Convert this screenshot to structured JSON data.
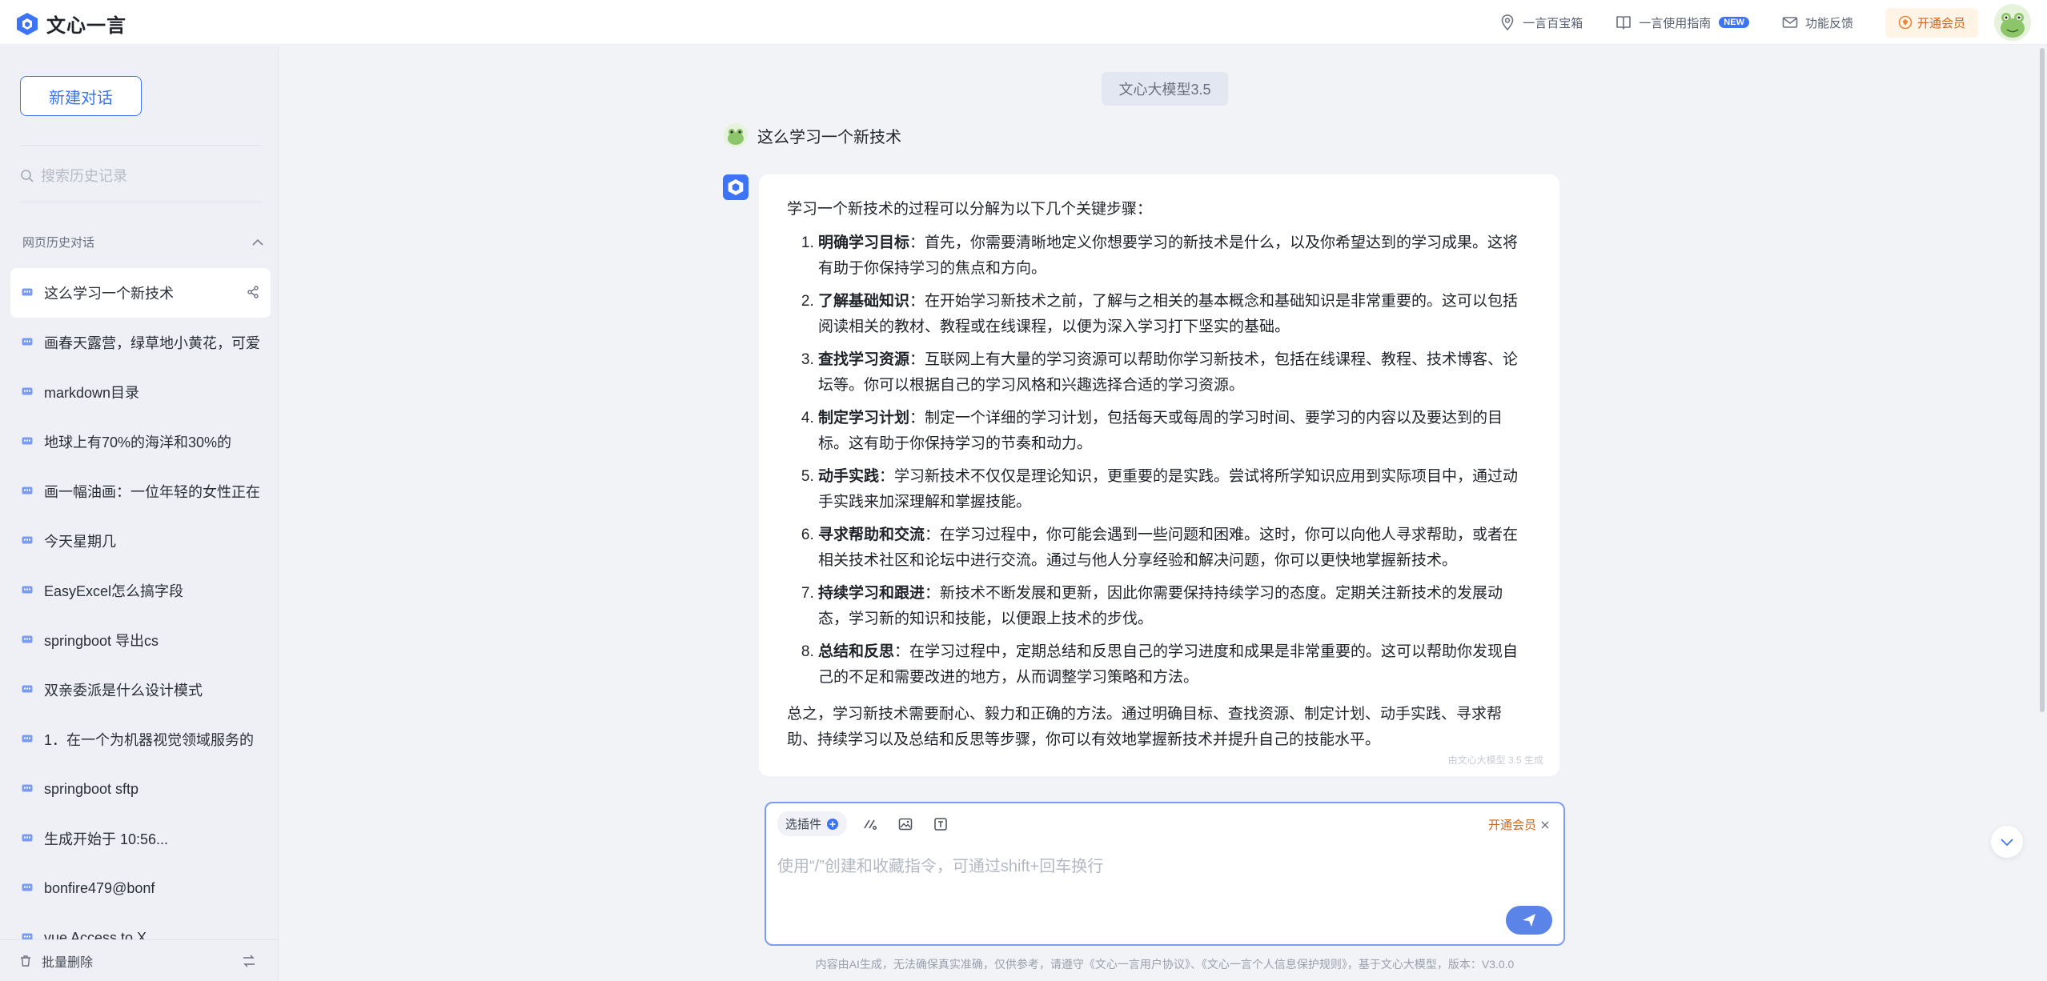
{
  "app": {
    "name": "文心一言"
  },
  "header": {
    "links": [
      {
        "label": "一言百宝箱",
        "icon": "location-pin-icon"
      },
      {
        "label": "一言使用指南",
        "icon": "book-icon",
        "badge": "NEW"
      },
      {
        "label": "功能反馈",
        "icon": "mail-icon"
      }
    ],
    "vip_label": "开通会员"
  },
  "sidebar": {
    "new_chat_label": "新建对话",
    "search_placeholder": "搜索历史记录",
    "history_header": "网页历史对话",
    "items": [
      {
        "label": "这么学习一个新技术"
      },
      {
        "label": "画春天露营，绿草地小黄花，可爱"
      },
      {
        "label": "markdown目录"
      },
      {
        "label": "地球上有70%的海洋和30%的"
      },
      {
        "label": "画一幅油画：一位年轻的女性正在"
      },
      {
        "label": "今天星期几"
      },
      {
        "label": "EasyExcel怎么搞字段"
      },
      {
        "label": "springboot 导出cs"
      },
      {
        "label": "双亲委派是什么设计模式"
      },
      {
        "label": "1．在一个为机器视觉领域服务的"
      },
      {
        "label": "springboot sftp"
      },
      {
        "label": "生成开始于 10:56..."
      },
      {
        "label": "bonfire479@bonf"
      },
      {
        "label": "vue Access to X"
      }
    ],
    "bulk_delete_label": "批量删除"
  },
  "chat": {
    "model_tag": "文心大模型3.5",
    "user_question": "这么学习一个新技术",
    "answer": {
      "intro": "学习一个新技术的过程可以分解为以下几个关键步骤：",
      "steps": [
        {
          "title": "明确学习目标",
          "text": "：首先，你需要清晰地定义你想要学习的新技术是什么，以及你希望达到的学习成果。这将有助于你保持学习的焦点和方向。"
        },
        {
          "title": "了解基础知识",
          "text": "：在开始学习新技术之前，了解与之相关的基本概念和基础知识是非常重要的。这可以包括阅读相关的教材、教程或在线课程，以便为深入学习打下坚实的基础。"
        },
        {
          "title": "查找学习资源",
          "text": "：互联网上有大量的学习资源可以帮助你学习新技术，包括在线课程、教程、技术博客、论坛等。你可以根据自己的学习风格和兴趣选择合适的学习资源。"
        },
        {
          "title": "制定学习计划",
          "text": "：制定一个详细的学习计划，包括每天或每周的学习时间、要学习的内容以及要达到的目标。这有助于你保持学习的节奏和动力。"
        },
        {
          "title": "动手实践",
          "text": "：学习新技术不仅仅是理论知识，更重要的是实践。尝试将所学知识应用到实际项目中，通过动手实践来加深理解和掌握技能。"
        },
        {
          "title": "寻求帮助和交流",
          "text": "：在学习过程中，你可能会遇到一些问题和困难。这时，你可以向他人寻求帮助，或者在相关技术社区和论坛中进行交流。通过与他人分享经验和解决问题，你可以更快地掌握新技术。"
        },
        {
          "title": "持续学习和跟进",
          "text": "：新技术不断发展和更新，因此你需要保持持续学习的态度。定期关注新技术的发展动态，学习新的知识和技能，以便跟上技术的步伐。"
        },
        {
          "title": "总结和反思",
          "text": "：在学习过程中，定期总结和反思自己的学习进度和成果是非常重要的。这可以帮助你发现自己的不足和需要改进的地方，从而调整学习策略和方法。"
        }
      ],
      "summary": "总之，学习新技术需要耐心、毅力和正确的方法。通过明确目标、查找资源、制定计划、动手实践、寻求帮助、持续学习以及总结和反思等步骤，你可以有效地掌握新技术并提升自己的技能水平。",
      "gen_note": "由文心大模型 3.5 生成"
    }
  },
  "composer": {
    "plugin_label": "选插件",
    "vip_label": "开通会员",
    "placeholder": "使用“/”创建和收藏指令，可通过shift+回车换行"
  },
  "footer": {
    "note": "内容由AI生成，无法确保真实准确，仅供参考，请遵守《文心一言用户协议》、《文心一言个人信息保护规则》，基于文心大模型，版本：V3.0.0"
  },
  "colors": {
    "accent": "#3d74f5",
    "vip": "#d1661b",
    "sidebar_bg": "#eef0f5",
    "main_bg": "#f2f3f7"
  }
}
